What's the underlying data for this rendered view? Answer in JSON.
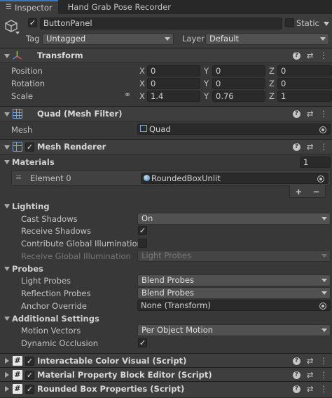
{
  "tabs": [
    {
      "label": "Inspector"
    },
    {
      "label": "Hand Grab Pose Recorder"
    }
  ],
  "object": {
    "name": "ButtonPanel",
    "static_label": "Static",
    "tag_label": "Tag",
    "tag_value": "Untagged",
    "layer_label": "Layer",
    "layer_value": "Default"
  },
  "transform": {
    "title": "Transform",
    "position_label": "Position",
    "rotation_label": "Rotation",
    "scale_label": "Scale",
    "position": {
      "x": "0",
      "y": "0",
      "z": "0"
    },
    "rotation": {
      "x": "0",
      "y": "0",
      "z": "0"
    },
    "scale": {
      "x": "1.4",
      "y": "0.76",
      "z": "1"
    },
    "axis_x": "X",
    "axis_y": "Y",
    "axis_z": "Z"
  },
  "mesh_filter": {
    "title": "Quad (Mesh Filter)",
    "mesh_label": "Mesh",
    "mesh_value": "Quad"
  },
  "mesh_renderer": {
    "title": "Mesh Renderer",
    "materials_label": "Materials",
    "materials_count": "1",
    "element_label": "Element 0",
    "element_value": "RoundedBoxUnlit",
    "plus": "+",
    "minus": "−",
    "lighting_label": "Lighting",
    "cast_shadows_label": "Cast Shadows",
    "cast_shadows_value": "On",
    "receive_shadows_label": "Receive Shadows",
    "contribute_gi_label": "Contribute Global Illumination",
    "receive_gi_label": "Receive Global Illumination",
    "receive_gi_value": "Light Probes",
    "probes_label": "Probes",
    "light_probes_label": "Light Probes",
    "light_probes_value": "Blend Probes",
    "reflection_probes_label": "Reflection Probes",
    "reflection_probes_value": "Blend Probes",
    "anchor_override_label": "Anchor Override",
    "anchor_override_value": "None (Transform)",
    "additional_label": "Additional Settings",
    "motion_vectors_label": "Motion Vectors",
    "motion_vectors_value": "Per Object Motion",
    "dynamic_occlusion_label": "Dynamic Occlusion"
  },
  "scripts": [
    {
      "title": "Interactable Color Visual (Script)"
    },
    {
      "title": "Material Property Block Editor (Script)"
    },
    {
      "title": "Rounded Box Properties (Script)"
    }
  ],
  "check": "✓"
}
